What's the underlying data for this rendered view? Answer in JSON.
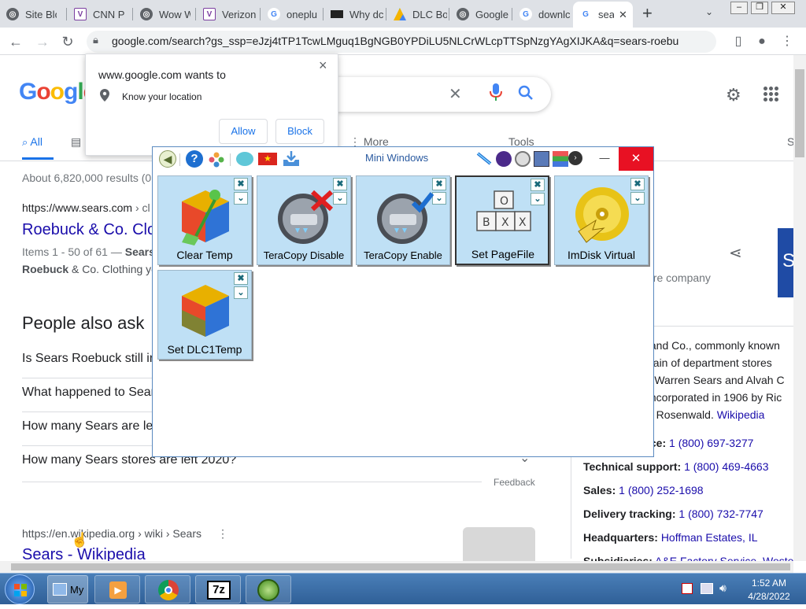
{
  "browser": {
    "tabs": [
      {
        "label": "Site Blo",
        "icon": "globe-icon",
        "color": "#5f6368"
      },
      {
        "label": "CNN P",
        "icon": "v-logo-icon",
        "color": "#7b3fa0"
      },
      {
        "label": "Wow W",
        "icon": "globe-icon",
        "color": "#5f6368"
      },
      {
        "label": "Verizon",
        "icon": "v-logo-icon",
        "color": "#7b3fa0"
      },
      {
        "label": "oneplu",
        "icon": "google-icon",
        "color": "#4285f4"
      },
      {
        "label": "Why dc",
        "icon": "film-icon",
        "color": "#222222"
      },
      {
        "label": "DLC Bo",
        "icon": "drive-icon",
        "color": "#f4b400"
      },
      {
        "label": "Google",
        "icon": "globe-icon",
        "color": "#5f6368"
      },
      {
        "label": "downlc",
        "icon": "google-icon",
        "color": "#4285f4"
      },
      {
        "label": "sea",
        "icon": "google-icon",
        "color": "#4285f4",
        "active": true
      }
    ],
    "new_tab": "+",
    "url": "google.com/search?gs_ssp=eJzj4tTP1TcwLMguq1BgNGB0YPDiLU5NLCrWLcpTTSpNzgYAgXIJKA&q=sears-roebu..."
  },
  "google": {
    "logo": "Google",
    "tabs": {
      "all": "All",
      "more": "More",
      "tools": "Tools",
      "s": "S"
    },
    "result_stats": "About 6,820,000 results (0",
    "result1": {
      "url": "https://www.sears.com",
      "url_suffix": "› cl",
      "title": "Roebuck & Co. Clo",
      "snippet1_prefix": "Items 1 - 50 of 61 —",
      "snippet1_bold": "Sears",
      "snippet2_bold": "Roebuck",
      "snippet2_rest": "& Co. Clothing yo"
    },
    "people_also_ask": {
      "heading": "People also ask",
      "questions": [
        "Is Sears Roebuck still in",
        "What happened to Sear",
        "How many Sears are le",
        "How many Sears stores are left 2020?"
      ],
      "feedback": "Feedback"
    },
    "result2": {
      "url": "https://en.wikipedia.org › wiki › Sears",
      "title": "Sears - Wikipedia"
    }
  },
  "knowledge_panel": {
    "subtitle": "ore company",
    "image_letter": "S",
    "desc_lines": [
      "k and Co., commonly known",
      "chain of department stores",
      "rd Warren Sears and Alvah C",
      "eincorporated in 1906 by Ric",
      "us Rosenwald."
    ],
    "wikipedia": "Wikipedia",
    "facts": [
      {
        "label": "ice:",
        "value": "1 (800) 697-3277"
      },
      {
        "label": "Technical support:",
        "value": "1 (800) 469-4663"
      },
      {
        "label": "Sales:",
        "value": "1 (800) 252-1698"
      },
      {
        "label": "Delivery tracking:",
        "value": "1 (800) 732-7747"
      },
      {
        "label": "Headquarters:",
        "value": "Hoffman Estates, IL"
      },
      {
        "label": "Subsidiaries:",
        "value": "A&E Factory Service, Wester"
      }
    ]
  },
  "location_popup": {
    "title": "www.google.com wants to",
    "permission": "Know your location",
    "allow": "Allow",
    "block": "Block",
    "close": "×"
  },
  "mini_windows": {
    "title": "Mini Windows",
    "minimize": "—",
    "close": "✕",
    "tiles": [
      {
        "label": "Clear Temp"
      },
      {
        "label": "TeraCopy Disable"
      },
      {
        "label": "TeraCopy Enable"
      },
      {
        "label": "Set PageFile",
        "selected": true
      },
      {
        "label": "ImDisk Virtual"
      },
      {
        "label": "Set DLC1Temp"
      }
    ]
  },
  "taskbar": {
    "my_label": "My",
    "time": "1:52 AM",
    "date": "4/28/2022",
    "sevenzip": "7z"
  },
  "colors": {
    "google_blue": "#4285f4",
    "google_red": "#ea4335",
    "google_yellow": "#fbbc05",
    "google_green": "#34a853",
    "link": "#1a0dab",
    "close_red": "#e81123"
  }
}
